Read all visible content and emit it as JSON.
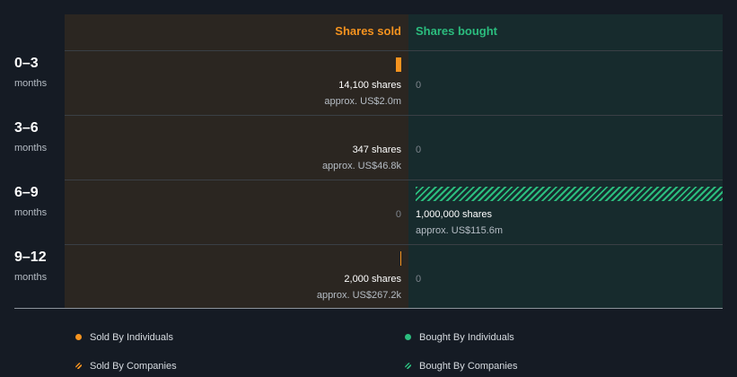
{
  "headers": {
    "sold": "Shares sold",
    "bought": "Shares bought"
  },
  "colors": {
    "sold": "#f5931f",
    "bought": "#2bbd7e",
    "sold_bg": "#2b2621",
    "bought_bg": "#172b2d"
  },
  "rows": [
    {
      "period": "0–3",
      "unit": "months",
      "sold": {
        "shares_label": "14,100 shares",
        "approx_label": "approx. US$2.0m"
      },
      "bought": {
        "zero_label": "0"
      }
    },
    {
      "period": "3–6",
      "unit": "months",
      "sold": {
        "shares_label": "347 shares",
        "approx_label": "approx. US$46.8k"
      },
      "bought": {
        "zero_label": "0"
      }
    },
    {
      "period": "6–9",
      "unit": "months",
      "sold": {
        "zero_label": "0"
      },
      "bought": {
        "shares_label": "1,000,000 shares",
        "approx_label": "approx. US$115.6m"
      }
    },
    {
      "period": "9–12",
      "unit": "months",
      "sold": {
        "shares_label": "2,000 shares",
        "approx_label": "approx. US$267.2k"
      },
      "bought": {
        "zero_label": "0"
      }
    }
  ],
  "legend": {
    "sold_individuals": "Sold By Individuals",
    "bought_individuals": "Bought By Individuals",
    "sold_companies": "Sold By Companies",
    "bought_companies": "Bought By Companies"
  },
  "chart_data": {
    "type": "bar",
    "categories": [
      "0–3 months",
      "3–6 months",
      "6–9 months",
      "9–12 months"
    ],
    "series": [
      {
        "name": "Shares sold",
        "values": [
          14100,
          347,
          0,
          2000
        ]
      },
      {
        "name": "Shares bought",
        "values": [
          0,
          0,
          1000000,
          0
        ]
      }
    ],
    "value_labels_usd": {
      "sold": [
        "US$2.0m",
        "US$46.8k",
        "",
        "US$267.2k"
      ],
      "bought": [
        "",
        "",
        "US$115.6m",
        ""
      ]
    },
    "legend_position": "bottom"
  }
}
